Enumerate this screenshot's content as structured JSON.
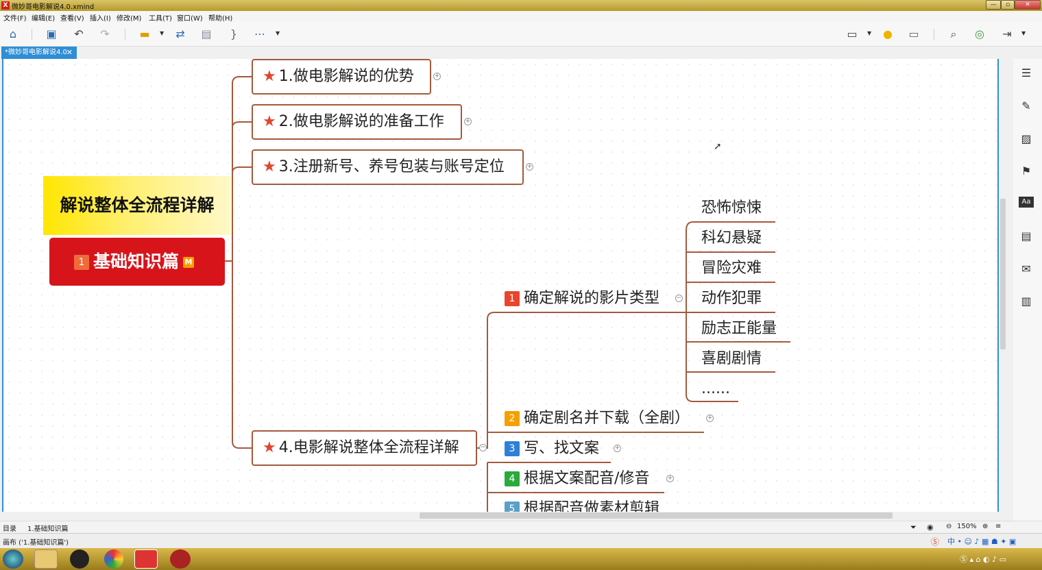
{
  "window": {
    "title": "微妙哥电影解说4.0.xmind",
    "app_icon": "xmind-icon"
  },
  "menu": [
    "文件(F)",
    "编辑(E)",
    "查看(V)",
    "插入(I)",
    "修改(M)",
    "工具(T)",
    "窗口(W)",
    "帮助(H)"
  ],
  "tab": {
    "label": "*微妙哥电影解说4.0",
    "close": "✕"
  },
  "mindmap": {
    "central_title": "解说整体全流程详解",
    "central_topic": {
      "badge": "1",
      "label": "基础知识篇",
      "marker": "M"
    },
    "branches": [
      {
        "label": "1.做电影解说的优势",
        "collapsed": true
      },
      {
        "label": "2.做电影解说的准备工作",
        "collapsed": true
      },
      {
        "label": "3.注册新号、养号包装与账号定位",
        "collapsed": true
      },
      {
        "label": "4.电影解说整体全流程详解",
        "collapsed": false
      }
    ],
    "subtopics": [
      {
        "num": "1",
        "color": "#e8452c",
        "label": "确定解说的影片类型"
      },
      {
        "num": "2",
        "color": "#f4a000",
        "label": "确定剧名并下载（全剧）"
      },
      {
        "num": "3",
        "color": "#2f7fd8",
        "label": "写、找文案"
      },
      {
        "num": "4",
        "color": "#2aaa3a",
        "label": "根据文案配音/修音"
      },
      {
        "num": "5",
        "color": "#5aa0c8",
        "label": "根据配音做素材剪辑"
      }
    ],
    "genres": [
      "恐怖惊悚",
      "科幻悬疑",
      "冒险灾难",
      "动作犯罪",
      "励志正能量",
      "喜剧剧情",
      "......"
    ]
  },
  "sheets": {
    "outline": "目录",
    "sheet": "1.基础知识篇"
  },
  "zoom": "150%",
  "status": "画布 ('1.基础知识篇')",
  "colors": {
    "accent": "#2e8ed6",
    "branch_line": "#a35a3c",
    "central": "#d8141b",
    "title_bg": "#ffe600"
  }
}
